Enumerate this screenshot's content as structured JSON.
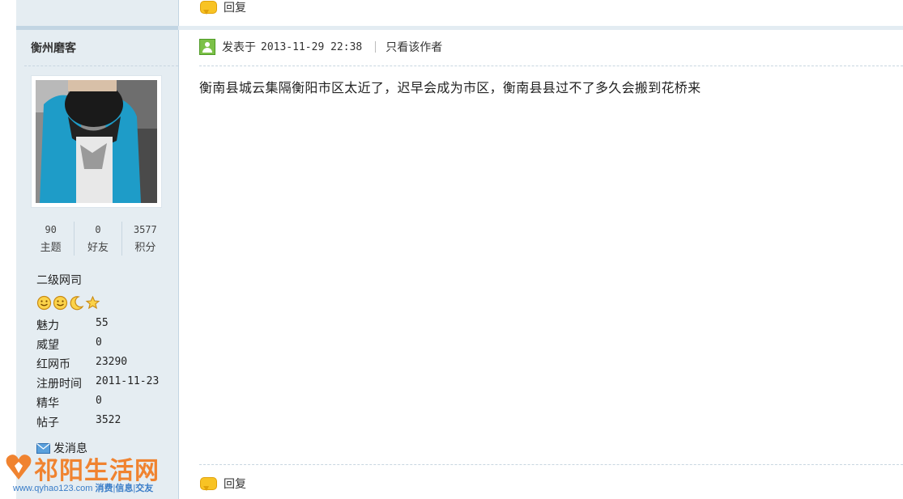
{
  "post_top": {
    "reply_label": "回复"
  },
  "author": {
    "name": "衡州磨客",
    "stats": [
      {
        "value": "90",
        "label": "主题"
      },
      {
        "value": "0",
        "label": "好友"
      },
      {
        "value": "3577",
        "label": "积分"
      }
    ],
    "group": "二级网司",
    "medals": [
      "smiley-icon",
      "smiley-icon",
      "moon-icon",
      "star-icon"
    ],
    "info": [
      {
        "key": "魅力",
        "value": "55"
      },
      {
        "key": "威望",
        "value": "0"
      },
      {
        "key": "红网币",
        "value": "23290"
      },
      {
        "key": "注册时间",
        "value": "2011-11-23"
      },
      {
        "key": "精华",
        "value": "0"
      },
      {
        "key": "帖子",
        "value": "3522"
      }
    ],
    "message_label": "发消息"
  },
  "post": {
    "posted_label": "发表于",
    "timestamp": "2013-11-29 22:38",
    "author_only_label": "只看该作者",
    "content": "衡南县城云集隔衡阳市区太近了，迟早会成为市区，衡南县县过不了多久会搬到花桥来",
    "reply_label": "回复"
  },
  "watermark": {
    "title": "祁阳生活网",
    "url": "www.qyhao123.com",
    "tags": [
      "消费",
      "信息",
      "交友"
    ]
  },
  "colors": {
    "sidebar_bg": "#e5edf2",
    "sidebar_border": "#c2d5e3",
    "logo_orange": "#f08330",
    "logo_blue": "#3a7dc8"
  }
}
